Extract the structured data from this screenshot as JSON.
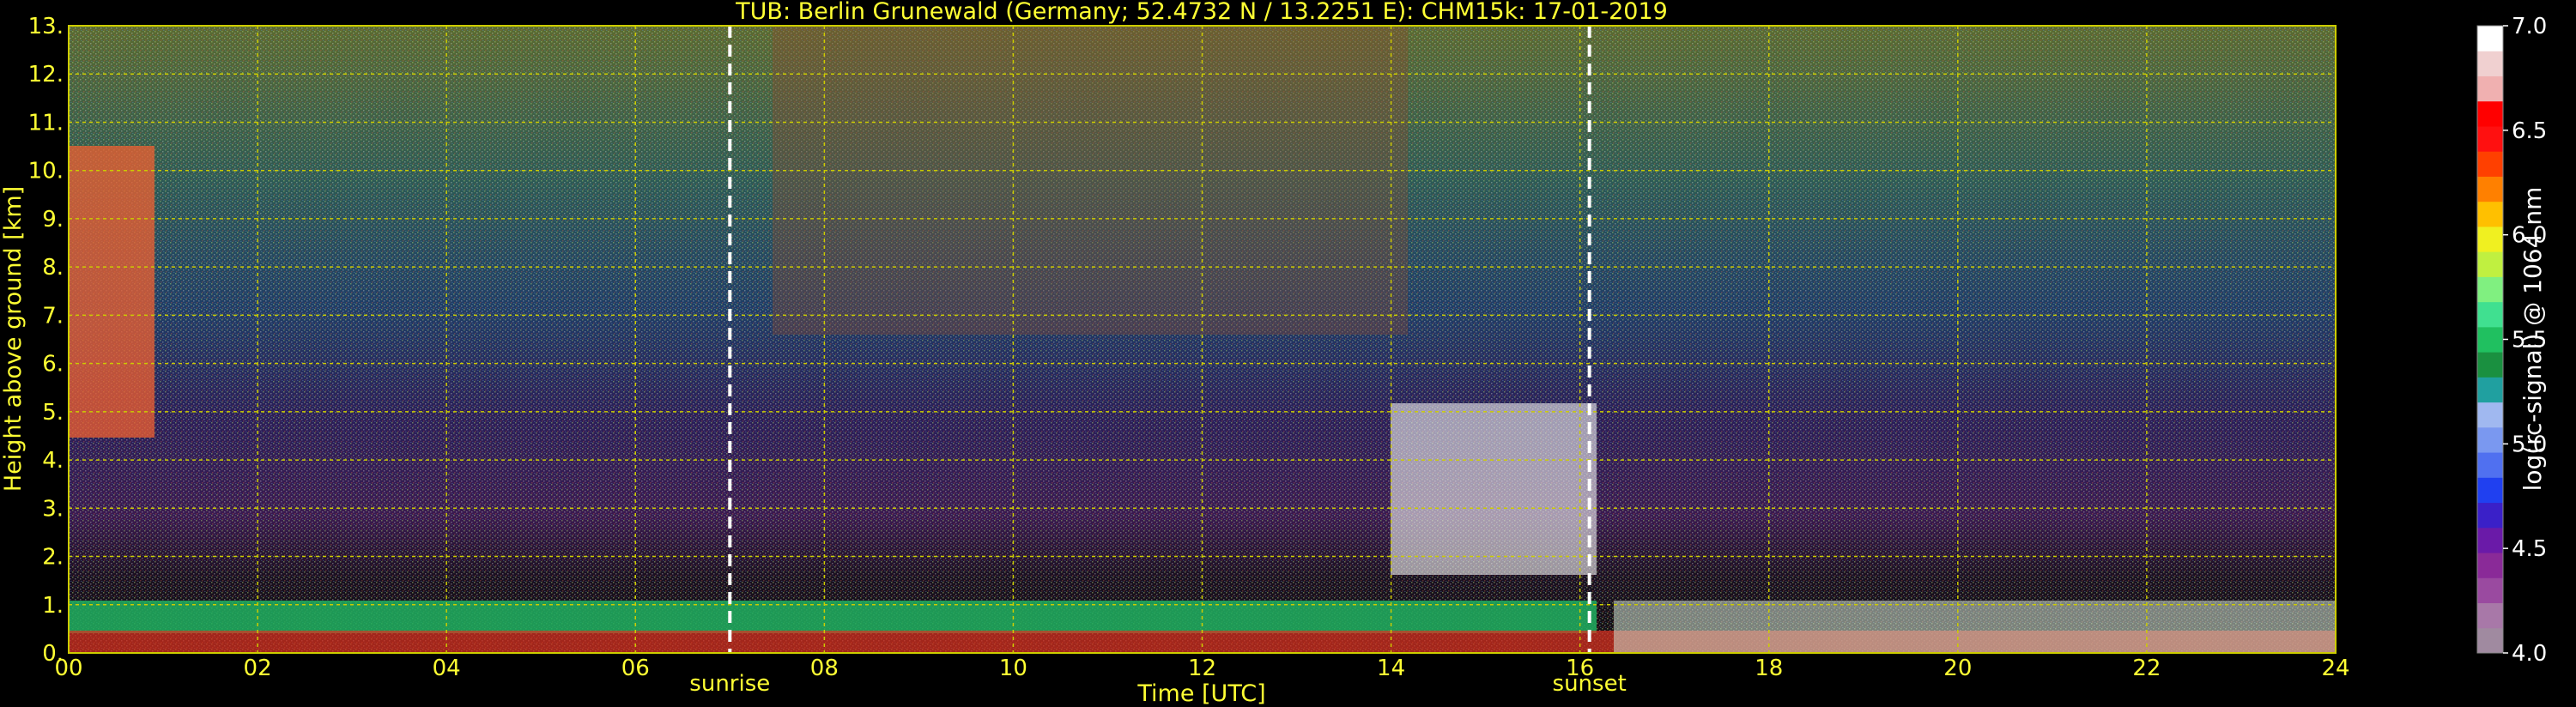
{
  "chart_data": {
    "type": "heatmap",
    "title": "TUB: Berlin Grunewald (Germany; 52.4732 N / 13.2251 E):    CHM15k: 17-01-2019",
    "xlabel": "Time [UTC]",
    "ylabel": "Height above ground [km]",
    "xlim": [
      0,
      24
    ],
    "ylim": [
      0,
      13
    ],
    "x_ticks": [
      "00",
      "02",
      "04",
      "06",
      "08",
      "10",
      "12",
      "14",
      "16",
      "18",
      "20",
      "22",
      "24"
    ],
    "y_ticks": [
      "0.",
      "1.",
      "2.",
      "3.",
      "4.",
      "5.",
      "6.",
      "7.",
      "8.",
      "9.",
      "10.",
      "11.",
      "12.",
      "13."
    ],
    "grid": true,
    "grid_color": "#cccc00",
    "annotations": [
      {
        "label": "sunrise",
        "x": 7.0
      },
      {
        "label": "sunset",
        "x": 16.1
      }
    ],
    "colorbar": {
      "label": "log(rc-signal) @ 1064 nm",
      "ticks": [
        "4.0",
        "4.5",
        "5.0",
        "5.5",
        "6.0",
        "6.5",
        "7.0"
      ],
      "range": [
        4.0,
        7.0
      ],
      "colors": [
        "#a08aa0",
        "#a878a8",
        "#9a4aa0",
        "#8a2a98",
        "#6a1aa8",
        "#3a20c8",
        "#2040f0",
        "#5070f0",
        "#7a98f0",
        "#a0b8f0",
        "#20a0a0",
        "#1a9040",
        "#20c060",
        "#40e090",
        "#80f080",
        "#c0f040",
        "#f0f020",
        "#ffc000",
        "#ff8000",
        "#ff4000",
        "#ff1010",
        "#ff0000",
        "#f0b0b0",
        "#f0d0d0",
        "#ffffff"
      ]
    }
  }
}
